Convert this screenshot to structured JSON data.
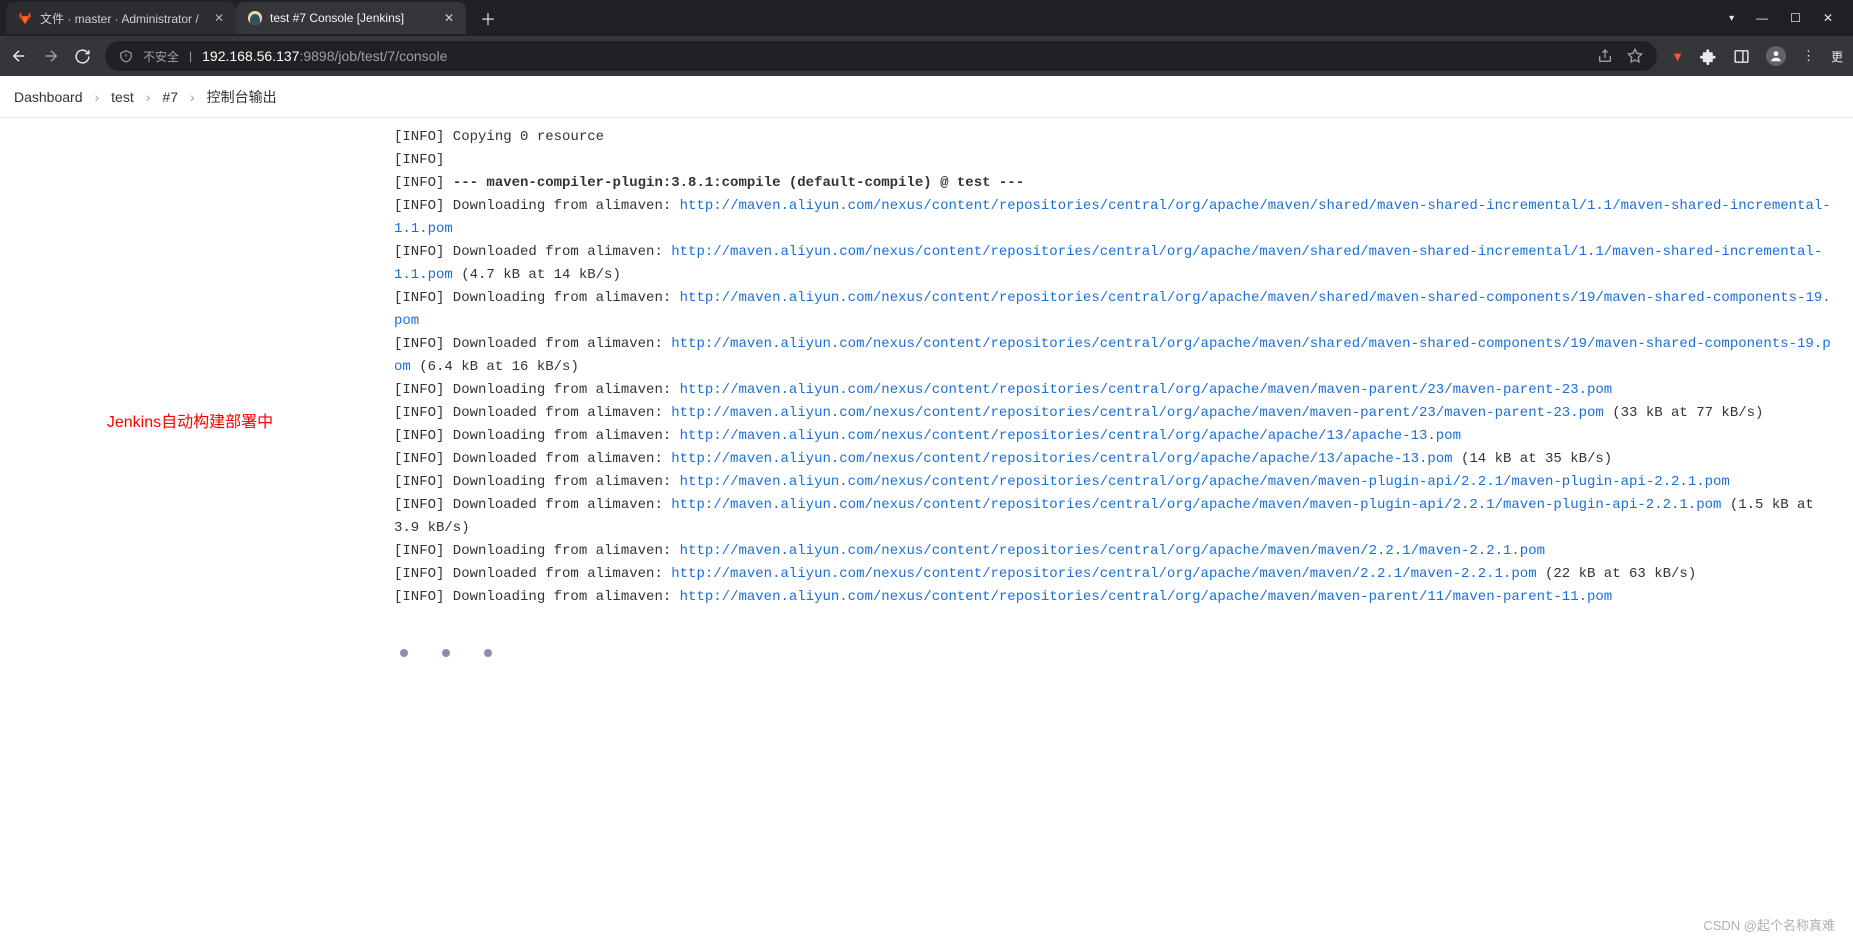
{
  "tabs": {
    "inactive_title": "文件 · master · Administrator /",
    "active_title": "test #7 Console [Jenkins]"
  },
  "address": {
    "insecure_label": "不安全",
    "sep": "|",
    "host": "192.168.56.137",
    "port_path": ":9898/job/test/7/console",
    "more": "更"
  },
  "breadcrumbs": {
    "items": [
      "Dashboard",
      "test",
      "#7",
      "控制台输出"
    ]
  },
  "side_note": "Jenkins自动构建部署中",
  "console": {
    "base_url": "http://maven.aliyun.com/nexus/content/repositories/central",
    "lines": [
      {
        "pre": "[INFO] Copying 0 resource"
      },
      {
        "pre": "[INFO] "
      },
      {
        "pre": "[INFO] ",
        "bold": "--- maven-compiler-plugin:3.8.1:compile (default-compile) @ test ---"
      },
      {
        "pre": "[INFO] Downloading from alimaven: ",
        "link": "/org/apache/maven/shared/maven-shared-incremental/1.1/maven-shared-incremental-1.1.pom"
      },
      {
        "pre": "[INFO] Downloaded from alimaven: ",
        "link": "/org/apache/maven/shared/maven-shared-incremental/1.1/maven-shared-incremental-1.1.pom",
        "post": " (4.7 kB at 14 kB/s)"
      },
      {
        "pre": "[INFO] Downloading from alimaven: ",
        "link": "/org/apache/maven/shared/maven-shared-components/19/maven-shared-components-19.pom"
      },
      {
        "pre": "[INFO] Downloaded from alimaven: ",
        "link": "/org/apache/maven/shared/maven-shared-components/19/maven-shared-components-19.pom",
        "post": " (6.4 kB at 16 kB/s)"
      },
      {
        "pre": "[INFO] Downloading from alimaven: ",
        "link": "/org/apache/maven/maven-parent/23/maven-parent-23.pom"
      },
      {
        "pre": "[INFO] Downloaded from alimaven: ",
        "link": "/org/apache/maven/maven-parent/23/maven-parent-23.pom",
        "post": " (33 kB at 77 kB/s)"
      },
      {
        "pre": "[INFO] Downloading from alimaven: ",
        "link": "/org/apache/apache/13/apache-13.pom"
      },
      {
        "pre": "[INFO] Downloaded from alimaven: ",
        "link": "/org/apache/apache/13/apache-13.pom",
        "post": " (14 kB at 35 kB/s)"
      },
      {
        "pre": "[INFO] Downloading from alimaven: ",
        "link": "/org/apache/maven/maven-plugin-api/2.2.1/maven-plugin-api-2.2.1.pom"
      },
      {
        "pre": "[INFO] Downloaded from alimaven: ",
        "link": "/org/apache/maven/maven-plugin-api/2.2.1/maven-plugin-api-2.2.1.pom",
        "post": " (1.5 kB at 3.9 kB/s)"
      },
      {
        "pre": "[INFO] Downloading from alimaven: ",
        "link": "/org/apache/maven/maven/2.2.1/maven-2.2.1.pom"
      },
      {
        "pre": "[INFO] Downloaded from alimaven: ",
        "link": "/org/apache/maven/maven/2.2.1/maven-2.2.1.pom",
        "post": " (22 kB at 63 kB/s)"
      },
      {
        "pre": "[INFO] Downloading from alimaven: ",
        "link": "/org/apache/maven/maven-parent/11/maven-parent-11.pom"
      }
    ]
  },
  "watermark": "CSDN @起个名称真难"
}
